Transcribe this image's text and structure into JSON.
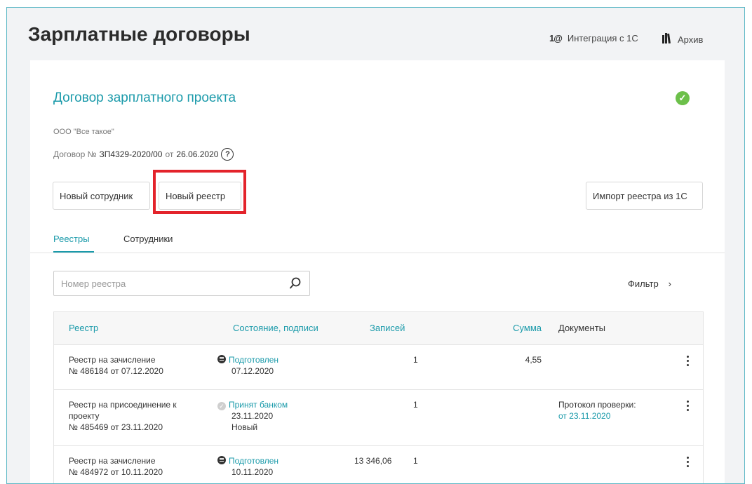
{
  "header": {
    "title": "Зарплатные договоры",
    "integration_icon": "1c-icon",
    "integration_label": "Интеграция с 1С",
    "archive_icon": "books-icon",
    "archive_label": "Архив"
  },
  "contract": {
    "title": "Договор зарплатного проекта",
    "status_icon": "check-circle-icon",
    "organization": "ООО \"Все такое\"",
    "number_prefix": "Договор №",
    "number": "ЗП4329-2020/00",
    "date_prefix": "от",
    "date": "26.06.2020",
    "help_icon": "?"
  },
  "actions": {
    "new_employee": "Новый сотрудник",
    "new_registry": "Новый реестр",
    "import_registry": "Импорт реестра из 1С"
  },
  "tabs": [
    {
      "label": "Реестры",
      "active": true
    },
    {
      "label": "Сотрудники",
      "active": false
    }
  ],
  "search": {
    "placeholder": "Номер реестра",
    "value": ""
  },
  "filter": {
    "label": "Фильтр",
    "chevron": "›"
  },
  "table": {
    "columns": [
      "Реестр",
      "Состояние, подписи",
      "Записей",
      "Сумма",
      "Документы"
    ],
    "rows": [
      {
        "name_line1": "Реестр на зачисление",
        "name_line2": "№ 486184 от 07.12.2020",
        "status": "Подготовлен",
        "status_date": "07.12.2020",
        "records": "1",
        "sum": "4,55"
      },
      {
        "name_line1": "Реестр на присоединение к",
        "name_line2": "проекту",
        "name_line3": "№ 485469 от 23.11.2020",
        "status": "Принят банком",
        "status_date": "23.11.2020",
        "status_note": "Новый",
        "records": "1",
        "sum": "",
        "doc_label": "Протокол проверки:",
        "doc_link": "от 23.11.2020"
      },
      {
        "name_line1": "Реестр на зачисление",
        "name_line2": "№ 484972 от 10.11.2020",
        "status": "Подготовлен",
        "status_date": "10.11.2020",
        "records": "1",
        "sum": "13 346,06"
      }
    ]
  },
  "colors": {
    "accent": "#1a9aaa",
    "success": "#6cc04a",
    "highlight": "#e3232b"
  }
}
